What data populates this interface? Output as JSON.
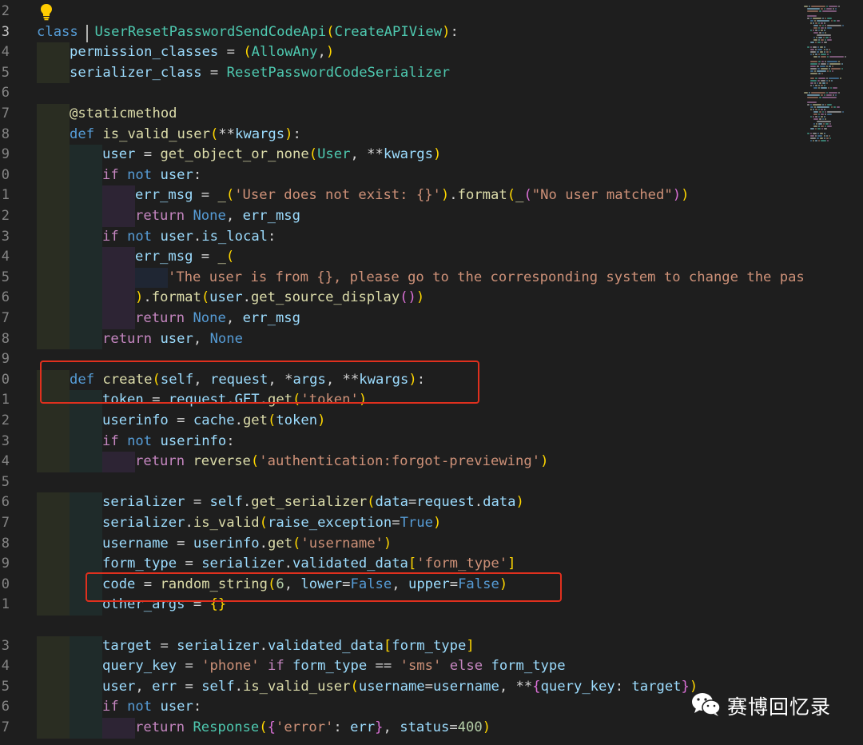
{
  "line_numbers": [
    "2",
    "3",
    "4",
    "5",
    "6",
    "7",
    "8",
    "9",
    "0",
    "1",
    "2",
    "3",
    "4",
    "5",
    "6",
    "7",
    "8",
    "9",
    "0",
    "1",
    "2",
    "3",
    "4",
    "5",
    "6",
    "7",
    "8",
    "9",
    "0",
    "1",
    "",
    "3",
    "4",
    "5",
    "6",
    "7"
  ],
  "active_line_index": 1,
  "code_lines": [
    {
      "indent": 0,
      "tokens": []
    },
    {
      "indent": 0,
      "tokens": [
        [
          "kw",
          "class"
        ],
        [
          "",
          "  "
        ],
        [
          "cls",
          "UserResetPasswordSendCodeApi"
        ],
        [
          "br1",
          "("
        ],
        [
          "cls",
          "CreateAPIView"
        ],
        [
          "br1",
          ")"
        ],
        [
          "",
          ":"
        ]
      ]
    },
    {
      "indent": 1,
      "tokens": [
        [
          "var",
          "permission_classes"
        ],
        [
          "",
          " = "
        ],
        [
          "br1",
          "("
        ],
        [
          "cls",
          "AllowAny"
        ],
        [
          "",
          ","
        ],
        [
          "br1",
          ")"
        ]
      ]
    },
    {
      "indent": 1,
      "tokens": [
        [
          "var",
          "serializer_class"
        ],
        [
          "",
          " = "
        ],
        [
          "cls",
          "ResetPasswordCodeSerializer"
        ]
      ]
    },
    {
      "indent": 0,
      "tokens": []
    },
    {
      "indent": 1,
      "tokens": [
        [
          "dec",
          "@staticmethod"
        ]
      ]
    },
    {
      "indent": 1,
      "tokens": [
        [
          "kw",
          "def"
        ],
        [
          "",
          " "
        ],
        [
          "fn",
          "is_valid_user"
        ],
        [
          "br1",
          "("
        ],
        [
          "",
          "**"
        ],
        [
          "prm",
          "kwargs"
        ],
        [
          "br1",
          ")"
        ],
        [
          "",
          ":"
        ]
      ]
    },
    {
      "indent": 2,
      "tokens": [
        [
          "var",
          "user"
        ],
        [
          "",
          " = "
        ],
        [
          "fn",
          "get_object_or_none"
        ],
        [
          "br1",
          "("
        ],
        [
          "cls",
          "User"
        ],
        [
          "",
          ", **"
        ],
        [
          "prm",
          "kwargs"
        ],
        [
          "br1",
          ")"
        ]
      ]
    },
    {
      "indent": 2,
      "tokens": [
        [
          "ctl",
          "if"
        ],
        [
          "",
          " "
        ],
        [
          "kw",
          "not"
        ],
        [
          "",
          " "
        ],
        [
          "var",
          "user"
        ],
        [
          "",
          ":"
        ]
      ]
    },
    {
      "indent": 3,
      "tokens": [
        [
          "var",
          "err_msg"
        ],
        [
          "",
          " = "
        ],
        [
          "fn",
          "_"
        ],
        [
          "br1",
          "("
        ],
        [
          "str",
          "'User does not exist: {}'"
        ],
        [
          "br1",
          ")"
        ],
        [
          "",
          "."
        ],
        [
          "fn",
          "format"
        ],
        [
          "br1",
          "("
        ],
        [
          "fn",
          "_"
        ],
        [
          "br2",
          "("
        ],
        [
          "str",
          "\"No user matched\""
        ],
        [
          "br2",
          ")"
        ],
        [
          "br1",
          ")"
        ]
      ]
    },
    {
      "indent": 3,
      "tokens": [
        [
          "ctl",
          "return"
        ],
        [
          "",
          " "
        ],
        [
          "kw",
          "None"
        ],
        [
          "",
          ", "
        ],
        [
          "var",
          "err_msg"
        ]
      ]
    },
    {
      "indent": 2,
      "tokens": [
        [
          "ctl",
          "if"
        ],
        [
          "",
          " "
        ],
        [
          "kw",
          "not"
        ],
        [
          "",
          " "
        ],
        [
          "var",
          "user"
        ],
        [
          "",
          "."
        ],
        [
          "var",
          "is_local"
        ],
        [
          "",
          ":"
        ]
      ]
    },
    {
      "indent": 3,
      "tokens": [
        [
          "var",
          "err_msg"
        ],
        [
          "",
          " = "
        ],
        [
          "fn",
          "_"
        ],
        [
          "br1",
          "("
        ]
      ]
    },
    {
      "indent": 4,
      "tokens": [
        [
          "str",
          "'The user is from {}, please go to the corresponding system to change the pas"
        ]
      ]
    },
    {
      "indent": 3,
      "tokens": [
        [
          "br1",
          ")"
        ],
        [
          "",
          "."
        ],
        [
          "fn",
          "format"
        ],
        [
          "br1",
          "("
        ],
        [
          "var",
          "user"
        ],
        [
          "",
          "."
        ],
        [
          "fn",
          "get_source_display"
        ],
        [
          "br2",
          "()"
        ],
        [
          "br1",
          ")"
        ]
      ]
    },
    {
      "indent": 3,
      "tokens": [
        [
          "ctl",
          "return"
        ],
        [
          "",
          " "
        ],
        [
          "kw",
          "None"
        ],
        [
          "",
          ", "
        ],
        [
          "var",
          "err_msg"
        ]
      ]
    },
    {
      "indent": 2,
      "tokens": [
        [
          "ctl",
          "return"
        ],
        [
          "",
          " "
        ],
        [
          "var",
          "user"
        ],
        [
          "",
          ", "
        ],
        [
          "kw",
          "None"
        ]
      ]
    },
    {
      "indent": 0,
      "tokens": []
    },
    {
      "indent": 1,
      "tokens": [
        [
          "kw",
          "def"
        ],
        [
          "",
          " "
        ],
        [
          "fn",
          "create"
        ],
        [
          "br1",
          "("
        ],
        [
          "selfc",
          "self"
        ],
        [
          "",
          ", "
        ],
        [
          "prm",
          "request"
        ],
        [
          "",
          ", *"
        ],
        [
          "prm",
          "args"
        ],
        [
          "",
          ", **"
        ],
        [
          "prm",
          "kwargs"
        ],
        [
          "br1",
          ")"
        ],
        [
          "",
          ":"
        ]
      ]
    },
    {
      "indent": 2,
      "tokens": [
        [
          "var",
          "token"
        ],
        [
          "",
          " = "
        ],
        [
          "var",
          "request"
        ],
        [
          "",
          "."
        ],
        [
          "var",
          "GET"
        ],
        [
          "",
          "."
        ],
        [
          "fn",
          "get"
        ],
        [
          "br1",
          "("
        ],
        [
          "str",
          "'token'"
        ],
        [
          "br1",
          ")"
        ]
      ]
    },
    {
      "indent": 2,
      "tokens": [
        [
          "var",
          "userinfo"
        ],
        [
          "",
          " = "
        ],
        [
          "var",
          "cache"
        ],
        [
          "",
          "."
        ],
        [
          "fn",
          "get"
        ],
        [
          "br1",
          "("
        ],
        [
          "var",
          "token"
        ],
        [
          "br1",
          ")"
        ]
      ]
    },
    {
      "indent": 2,
      "tokens": [
        [
          "ctl",
          "if"
        ],
        [
          "",
          " "
        ],
        [
          "kw",
          "not"
        ],
        [
          "",
          " "
        ],
        [
          "var",
          "userinfo"
        ],
        [
          "",
          ":"
        ]
      ]
    },
    {
      "indent": 3,
      "tokens": [
        [
          "ctl",
          "return"
        ],
        [
          "",
          " "
        ],
        [
          "fn",
          "reverse"
        ],
        [
          "br1",
          "("
        ],
        [
          "str",
          "'authentication:forgot-previewing'"
        ],
        [
          "br1",
          ")"
        ]
      ]
    },
    {
      "indent": 0,
      "tokens": []
    },
    {
      "indent": 2,
      "tokens": [
        [
          "var",
          "serializer"
        ],
        [
          "",
          " = "
        ],
        [
          "selfc",
          "self"
        ],
        [
          "",
          "."
        ],
        [
          "fn",
          "get_serializer"
        ],
        [
          "br1",
          "("
        ],
        [
          "prm",
          "data"
        ],
        [
          "",
          "="
        ],
        [
          "var",
          "request"
        ],
        [
          "",
          "."
        ],
        [
          "var",
          "data"
        ],
        [
          "br1",
          ")"
        ]
      ]
    },
    {
      "indent": 2,
      "tokens": [
        [
          "var",
          "serializer"
        ],
        [
          "",
          "."
        ],
        [
          "fn",
          "is_valid"
        ],
        [
          "br1",
          "("
        ],
        [
          "prm",
          "raise_exception"
        ],
        [
          "",
          "="
        ],
        [
          "kw",
          "True"
        ],
        [
          "br1",
          ")"
        ]
      ]
    },
    {
      "indent": 2,
      "tokens": [
        [
          "var",
          "username"
        ],
        [
          "",
          " = "
        ],
        [
          "var",
          "userinfo"
        ],
        [
          "",
          "."
        ],
        [
          "fn",
          "get"
        ],
        [
          "br1",
          "("
        ],
        [
          "str",
          "'username'"
        ],
        [
          "br1",
          ")"
        ]
      ]
    },
    {
      "indent": 2,
      "tokens": [
        [
          "var",
          "form_type"
        ],
        [
          "",
          " = "
        ],
        [
          "var",
          "serializer"
        ],
        [
          "",
          "."
        ],
        [
          "var",
          "validated_data"
        ],
        [
          "br1",
          "["
        ],
        [
          "str",
          "'form_type'"
        ],
        [
          "br1",
          "]"
        ]
      ]
    },
    {
      "indent": 2,
      "tokens": [
        [
          "var",
          "code"
        ],
        [
          "",
          " = "
        ],
        [
          "fn",
          "random_string"
        ],
        [
          "br1",
          "("
        ],
        [
          "num",
          "6"
        ],
        [
          "",
          ", "
        ],
        [
          "prm",
          "lower"
        ],
        [
          "",
          "="
        ],
        [
          "kw",
          "False"
        ],
        [
          "",
          ", "
        ],
        [
          "prm",
          "upper"
        ],
        [
          "",
          "="
        ],
        [
          "kw",
          "False"
        ],
        [
          "br1",
          ")"
        ]
      ]
    },
    {
      "indent": 2,
      "tokens": [
        [
          "var",
          "other_args"
        ],
        [
          "",
          " = "
        ],
        [
          "br1",
          "{}"
        ]
      ]
    },
    {
      "indent": 0,
      "tokens": []
    },
    {
      "indent": 2,
      "tokens": [
        [
          "var",
          "target"
        ],
        [
          "",
          " = "
        ],
        [
          "var",
          "serializer"
        ],
        [
          "",
          "."
        ],
        [
          "var",
          "validated_data"
        ],
        [
          "br1",
          "["
        ],
        [
          "var",
          "form_type"
        ],
        [
          "br1",
          "]"
        ]
      ]
    },
    {
      "indent": 2,
      "tokens": [
        [
          "var",
          "query_key"
        ],
        [
          "",
          " = "
        ],
        [
          "str",
          "'phone'"
        ],
        [
          "",
          " "
        ],
        [
          "ctl",
          "if"
        ],
        [
          "",
          " "
        ],
        [
          "var",
          "form_type"
        ],
        [
          "",
          " == "
        ],
        [
          "str",
          "'sms'"
        ],
        [
          "",
          " "
        ],
        [
          "ctl",
          "else"
        ],
        [
          "",
          " "
        ],
        [
          "var",
          "form_type"
        ]
      ]
    },
    {
      "indent": 2,
      "tokens": [
        [
          "var",
          "user"
        ],
        [
          "",
          ", "
        ],
        [
          "var",
          "err"
        ],
        [
          "",
          " = "
        ],
        [
          "selfc",
          "self"
        ],
        [
          "",
          "."
        ],
        [
          "fn",
          "is_valid_user"
        ],
        [
          "br1",
          "("
        ],
        [
          "prm",
          "username"
        ],
        [
          "",
          "="
        ],
        [
          "var",
          "username"
        ],
        [
          "",
          ", **"
        ],
        [
          "br2",
          "{"
        ],
        [
          "var",
          "query_key"
        ],
        [
          "",
          ": "
        ],
        [
          "var",
          "target"
        ],
        [
          "br2",
          "}"
        ],
        [
          "br1",
          ")"
        ]
      ]
    },
    {
      "indent": 2,
      "tokens": [
        [
          "ctl",
          "if"
        ],
        [
          "",
          " "
        ],
        [
          "kw",
          "not"
        ],
        [
          "",
          " "
        ],
        [
          "var",
          "user"
        ],
        [
          "",
          ":"
        ]
      ]
    },
    {
      "indent": 3,
      "tokens": [
        [
          "ctl",
          "return"
        ],
        [
          "",
          " "
        ],
        [
          "cls",
          "Response"
        ],
        [
          "br1",
          "("
        ],
        [
          "br2",
          "{"
        ],
        [
          "str",
          "'error'"
        ],
        [
          "",
          ": "
        ],
        [
          "var",
          "err"
        ],
        [
          "br2",
          "}"
        ],
        [
          "",
          ", "
        ],
        [
          "prm",
          "status"
        ],
        [
          "",
          "="
        ],
        [
          "num",
          "400"
        ],
        [
          "br1",
          ")"
        ]
      ]
    }
  ],
  "highlight_boxes": [
    {
      "label": "def create(self, request, *args, **kwargs):"
    },
    {
      "label": "code = random_string(6, lower=False, upper=False)"
    }
  ],
  "watermark": {
    "text": "赛博回忆录",
    "icon": "wechat-icon"
  },
  "colors": {
    "background": "#1e1e1e",
    "keyword": "#569cd6",
    "control": "#c586c0",
    "function": "#dcdcaa",
    "class": "#4ec9b0",
    "string": "#ce9178",
    "number": "#b5cea8",
    "variable": "#9cdcfe",
    "highlight_box": "#e0301e"
  }
}
